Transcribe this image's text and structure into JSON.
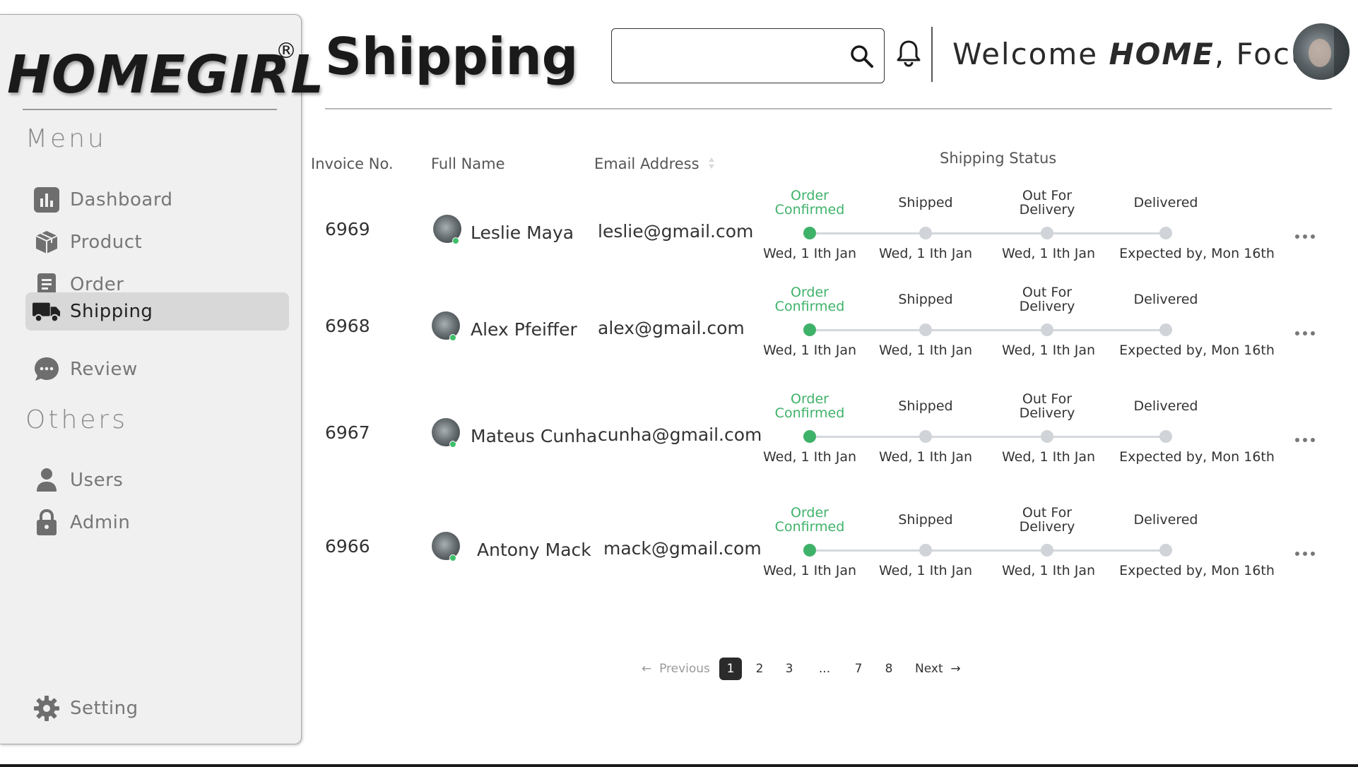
{
  "brand": {
    "name": "HOMEGIRL",
    "reg_mark": "®"
  },
  "sidebar": {
    "menu_title": "Menu",
    "items": [
      {
        "label": "Dashboard",
        "icon": "bar-chart-icon"
      },
      {
        "label": "Product",
        "icon": "box-icon"
      },
      {
        "label": "Order",
        "icon": "document-icon"
      },
      {
        "label": "Shipping",
        "icon": "truck-icon",
        "active": true
      },
      {
        "label": "Review",
        "icon": "chat-bubble-icon"
      }
    ],
    "others_title": "Others",
    "others": [
      {
        "label": "Users",
        "icon": "user-icon"
      },
      {
        "label": "Admin",
        "icon": "lock-icon"
      }
    ],
    "setting_label": "Setting"
  },
  "header": {
    "title": "Shipping",
    "search_placeholder": "",
    "welcome_prefix": "Welcome ",
    "welcome_bold": "HOME",
    "welcome_suffix": ", Focus"
  },
  "table": {
    "columns": {
      "invoice": "Invoice No.",
      "name": "Full Name",
      "email": "Email Address",
      "status": "Shipping Status"
    },
    "steps": [
      "Order Confirmed",
      "Shipped",
      "Out For Delivery",
      "Delivered"
    ],
    "rows": [
      {
        "invoice": "6969",
        "name": "Leslie Maya",
        "email": "leslie@gmail.com",
        "dates": [
          "Wed, 1 Ith Jan",
          "Wed, 1 Ith Jan",
          "Wed, 1 Ith Jan",
          "Expected by, Mon 16th"
        ],
        "progress_step": 1
      },
      {
        "invoice": "6968",
        "name": "Alex Pfeiffer",
        "email": "alex@gmail.com",
        "dates": [
          "Wed, 1 Ith Jan",
          "Wed, 1 Ith Jan",
          "Wed, 1 Ith Jan",
          "Expected by, Mon 16th"
        ],
        "progress_step": 1
      },
      {
        "invoice": "6967",
        "name": "Mateus Cunha",
        "email": "cunha@gmail.com",
        "dates": [
          "Wed, 1 Ith Jan",
          "Wed, 1 Ith Jan",
          "Wed, 1 Ith Jan",
          "Expected by, Mon 16th"
        ],
        "progress_step": 1
      },
      {
        "invoice": "6966",
        "name": "Antony Mack",
        "email": "mack@gmail.com",
        "dates": [
          "Wed, 1 Ith Jan",
          "Wed, 1 Ith Jan",
          "Wed, 1 Ith Jan",
          "Expected by, Mon 16th"
        ],
        "progress_step": 1
      }
    ]
  },
  "pagination": {
    "previous": "Previous",
    "pages": [
      "1",
      "2",
      "3",
      "...",
      "7",
      "8"
    ],
    "current": "1",
    "next": "Next"
  },
  "colors": {
    "accent_green": "#3fb26a",
    "active_nav": "#d8d8d8",
    "sidebar_bg": "#f0f0f0",
    "pagination_active": "#2b2b2b"
  }
}
